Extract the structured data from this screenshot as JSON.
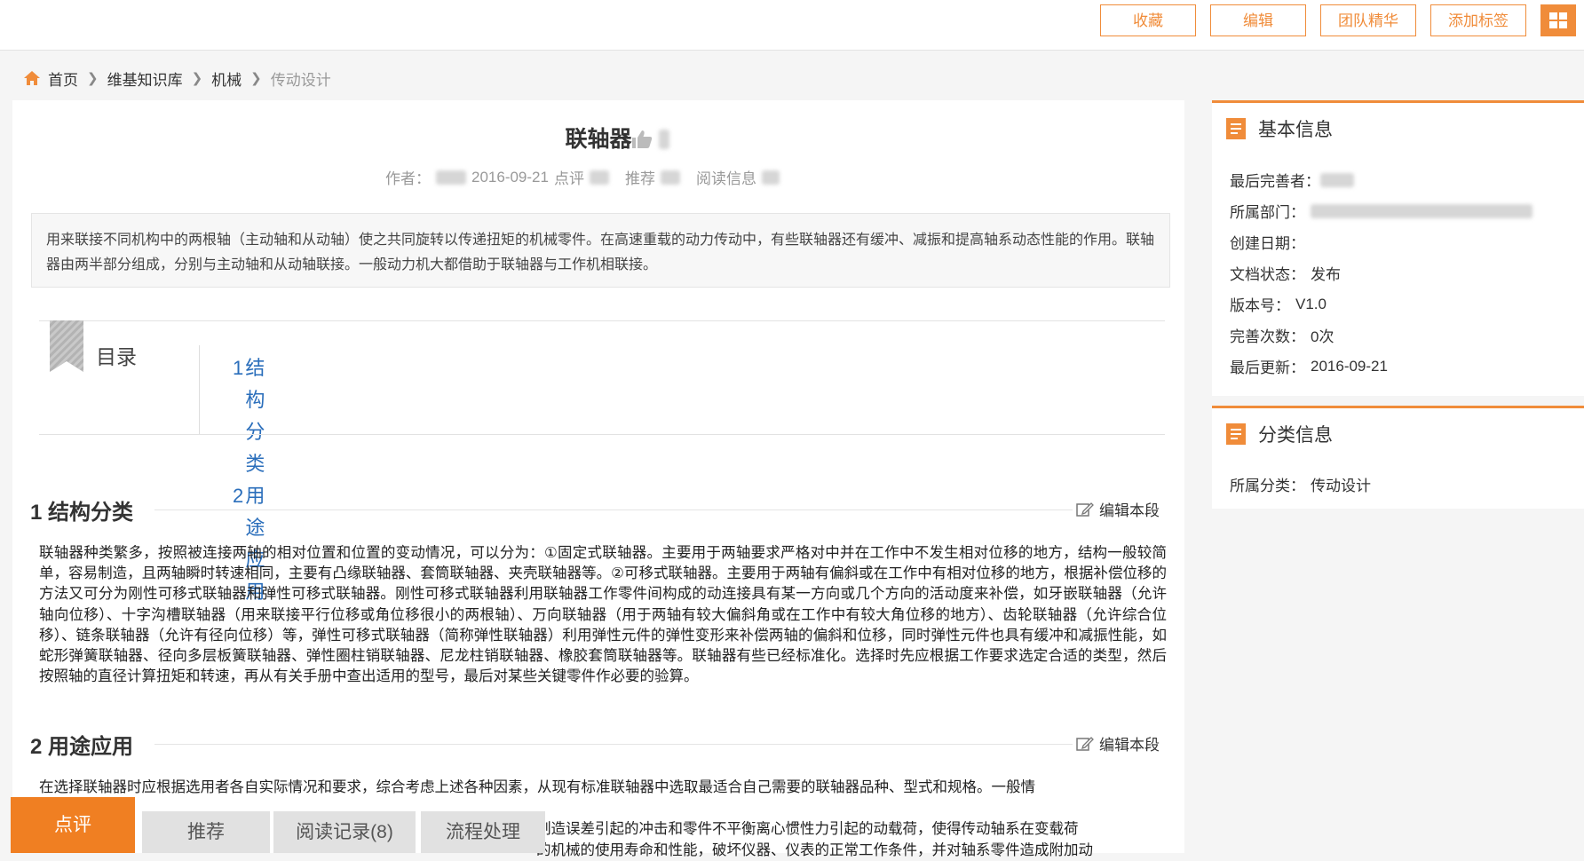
{
  "header": {
    "buttons": [
      "收藏",
      "编辑",
      "团队精华",
      "添加标签"
    ],
    "grid_icon": "grid-icon"
  },
  "breadcrumb": {
    "items": [
      "首页",
      "维基知识库",
      "机械"
    ],
    "current": "传动设计"
  },
  "article": {
    "title": "联轴器",
    "meta": {
      "author_label": "作者：",
      "date": "2016-09-21",
      "comment_label": "点评",
      "recommend_label": "推荐",
      "read_label": "阅读信息"
    },
    "summary": "用来联接不同机构中的两根轴（主动轴和从动轴）使之共同旋转以传递扭矩的机械零件。在高速重载的动力传动中，有些联轴器还有缓冲、减振和提高轴系动态性能的作用。联轴器由两半部分组成，分别与主动轴和从动轴联接。一般动力机大都借助于联轴器与工作机相联接。",
    "toc": {
      "title": "目录",
      "items": [
        {
          "num": "1",
          "label": "结构分类"
        },
        {
          "num": "2",
          "label": "用途应用"
        }
      ]
    },
    "edit_label": "编辑本段",
    "sections": [
      {
        "heading": "1 结构分类",
        "body": "联轴器种类繁多，按照被连接两轴的相对位置和位置的变动情况，可以分为：①固定式联轴器。主要用于两轴要求严格对中并在工作中不发生相对位移的地方，结构一般较简单，容易制造，且两轴瞬时转速相同，主要有凸缘联轴器、套筒联轴器、夹壳联轴器等。②可移式联轴器。主要用于两轴有偏斜或在工作中有相对位移的地方，根据补偿位移的方法又可分为刚性可移式联轴器和弹性可移式联轴器。刚性可移式联轴器利用联轴器工作零件间构成的动连接具有某一方向或几个方向的活动度来补偿，如牙嵌联轴器（允许轴向位移）、十字沟槽联轴器（用来联接平行位移或角位移很小的两根轴）、万向联轴器（用于两轴有较大偏斜角或在工作中有较大角位移的地方）、齿轮联轴器（允许综合位移）、链条联轴器（允许有径向位移）等，弹性可移式联轴器（简称弹性联轴器）利用弹性元件的弹性变形来补偿两轴的偏斜和位移，同时弹性元件也具有缓冲和减振性能，如蛇形弹簧联轴器、径向多层板簧联轴器、弹性圈柱销联轴器、尼龙柱销联轴器、橡胶套筒联轴器等。联轴器有些已经标准化。选择时先应根据工作要求选定合适的类型，然后按照轴的直径计算扭矩和转速，再从有关手册中查出适用的型号，最后对某些关键零件作必要的验算。"
      },
      {
        "heading": "2 用途应用",
        "body_line1": "在选择联轴器时应根据选用者各自实际情况和要求，综合考虑上述各种因素，从现有标准联轴器中选取最适合自己需要的联轴器品种、型式和规格。一般情",
        "body_line2": "制造误差引起的冲击和零件不平衡离心惯性力引起的动载荷，使得传动轴系在变载荷",
        "body_line3": "的机械的使用寿命和性能，破坏仪器、仪表的正常工作条件，并对轴系零件造成附加动"
      }
    ]
  },
  "bottom_bar": {
    "comment": "点评",
    "recommend": "推荐",
    "read_records": "阅读记录(8)",
    "workflow": "流程处理"
  },
  "sidebar": {
    "basic": {
      "title": "基本信息",
      "rows": [
        {
          "label": "最后完善者：",
          "value": ""
        },
        {
          "label": "所属部门：",
          "value": ""
        },
        {
          "label": "创建日期：",
          "value": ""
        },
        {
          "label": "文档状态：",
          "value": "发布"
        },
        {
          "label": "版本号：",
          "value": "V1.0"
        },
        {
          "label": "完善次数：",
          "value": "0次"
        },
        {
          "label": "最后更新：",
          "value": "2016-09-21"
        }
      ]
    },
    "category": {
      "title": "分类信息",
      "rows": [
        {
          "label": "所属分类：",
          "value": "传动设计"
        }
      ]
    }
  },
  "colors": {
    "accent": "#f08c3a",
    "link": "#2a6ebb"
  }
}
